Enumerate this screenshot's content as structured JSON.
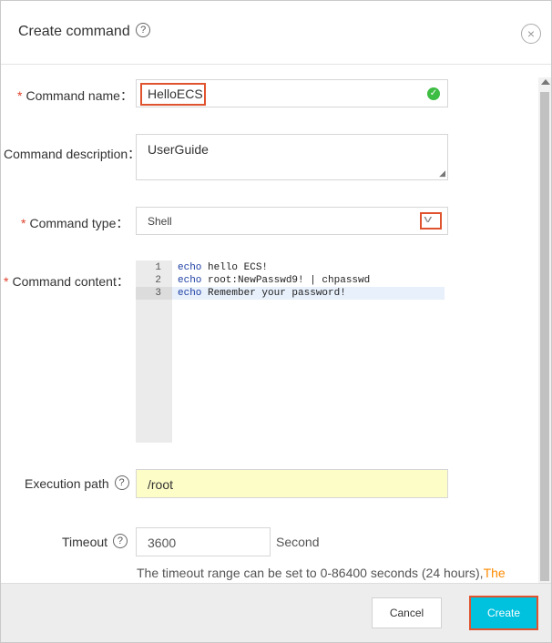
{
  "dialog": {
    "title": "Create command",
    "help": "?",
    "close": "×"
  },
  "form": {
    "command_name": {
      "label": "Command name：",
      "value": "HelloECS"
    },
    "command_description": {
      "label": "Command description：",
      "value": "UserGuide"
    },
    "command_type": {
      "label": "Command type：",
      "value": "Shell"
    },
    "command_content": {
      "label": "Command content：",
      "lines": [
        {
          "num": "1",
          "kw": "echo",
          "rest": " hello ECS!"
        },
        {
          "num": "2",
          "kw": "echo",
          "rest": " root:NewPasswd9! | chpasswd"
        },
        {
          "num": "3",
          "kw": "echo",
          "rest": " Remember your password!"
        }
      ]
    },
    "execution_path": {
      "label": "Execution path",
      "value": "/root"
    },
    "timeout": {
      "label": "Timeout",
      "value": "3600",
      "unit": "Second",
      "hint": "The timeout range can be set to 0-86400 seconds (24 hours),",
      "hint_link": "The"
    },
    "required_mark": "*"
  },
  "footer": {
    "cancel_label": "Cancel",
    "create_label": "Create"
  },
  "colors": {
    "accent": "#00c1de",
    "highlight_border": "#e0532f",
    "required": "#e0402b",
    "success": "#3dbd41",
    "exec_path_bg": "#fdfdc8",
    "link": "#ff8a00"
  }
}
